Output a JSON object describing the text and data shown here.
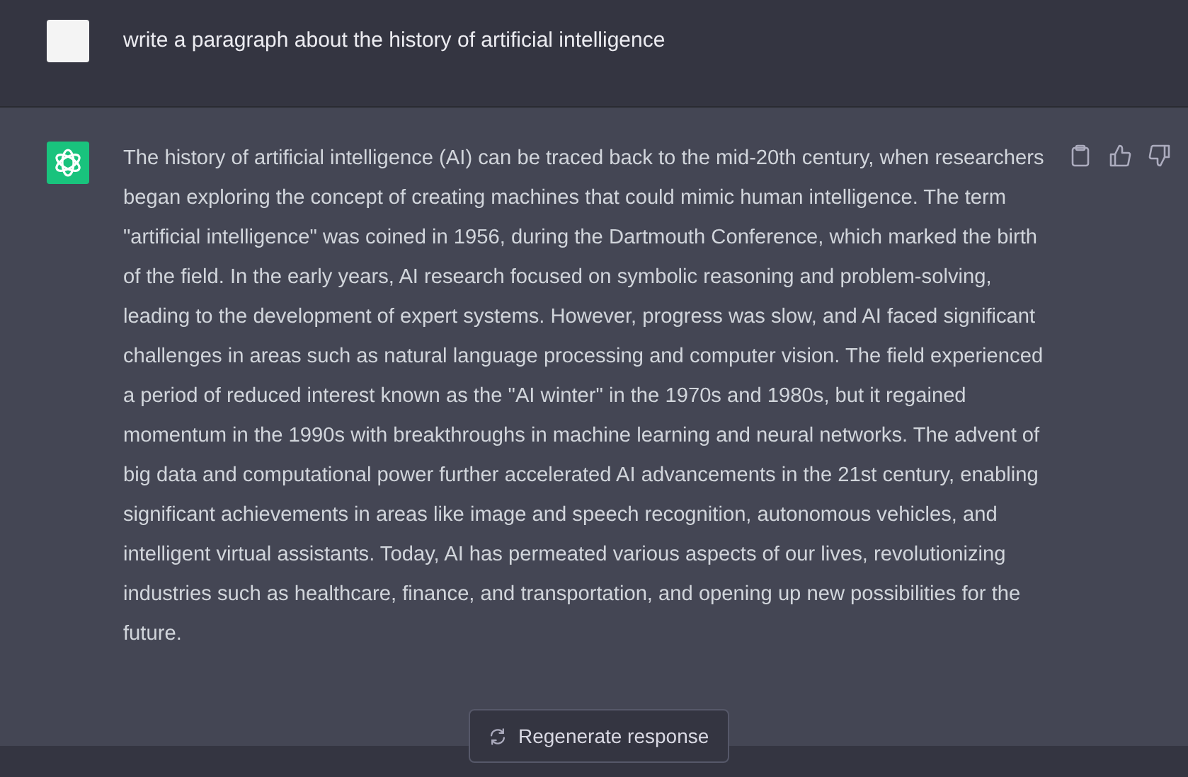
{
  "messages": [
    {
      "kind": "user",
      "text": "write a paragraph about the history of artificial intelligence"
    },
    {
      "kind": "assistant",
      "text": "The history of artificial intelligence (AI) can be traced back to the mid-20th century, when researchers began exploring the concept of creating machines that could mimic human intelligence. The term \"artificial intelligence\" was coined in 1956, during the Dartmouth Conference, which marked the birth of the field. In the early years, AI research focused on symbolic reasoning and problem-solving, leading to the development of expert systems. However, progress was slow, and AI faced significant challenges in areas such as natural language processing and computer vision. The field experienced a period of reduced interest known as the \"AI winter\" in the 1970s and 1980s, but it regained momentum in the 1990s with breakthroughs in machine learning and neural networks. The advent of big data and computational power further accelerated AI advancements in the 21st century, enabling significant achievements in areas like image and speech recognition, autonomous vehicles, and intelligent virtual assistants. Today, AI has permeated various aspects of our lives, revolutionizing industries such as healthcare, finance, and transportation, and opening up new possibilities for the future."
    }
  ],
  "regenerate_button": "Regenerate response"
}
